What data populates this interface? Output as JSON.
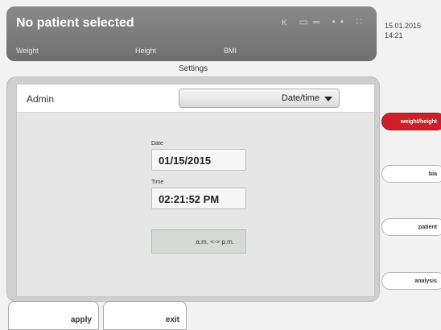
{
  "header": {
    "title": "No patient selected",
    "status_icons": "ĸ ▭═ •• ∷",
    "metrics": [
      "Weight",
      "Height",
      "BMI"
    ]
  },
  "clock": {
    "date": "15.01.2015",
    "time": "14:21"
  },
  "settings_title": "Settings",
  "panel": {
    "section": "Admin",
    "dropdown": "Date/time",
    "date_label": "Date",
    "date_value": "01/15/2015",
    "time_label": "Time",
    "time_value": "02:21:52 PM",
    "ampm_button": "a.m. <-> p.m."
  },
  "bottom_buttons": {
    "apply": "apply",
    "exit": "exit"
  },
  "side_tabs": [
    {
      "label": "weight/height",
      "active": true
    },
    {
      "label": "bia",
      "active": false
    },
    {
      "label": "patient",
      "active": false
    },
    {
      "label": "analysis",
      "active": false
    }
  ],
  "colors": {
    "header_bg": "#7a7a7a",
    "active_tab": "#cc1f26"
  }
}
